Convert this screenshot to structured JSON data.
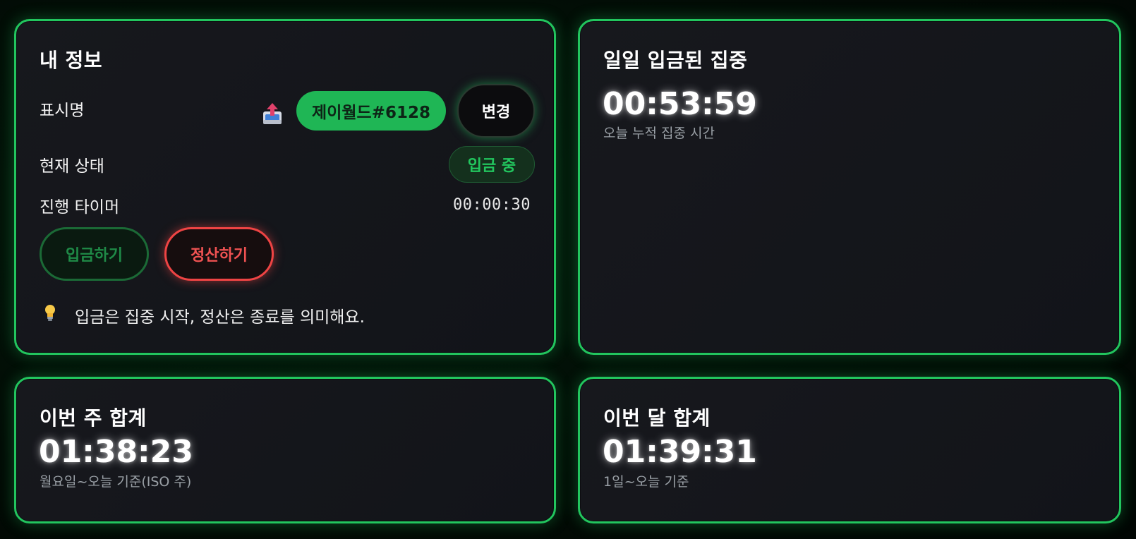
{
  "info": {
    "title": "내 정보",
    "display_name_label": "표시명",
    "display_name_value": "제이월드#6128",
    "change_label": "변경",
    "status_label": "현재 상태",
    "status_value": "입금 중",
    "timer_label": "진행 타이머",
    "timer_value": "00:00:30",
    "deposit_label": "입금하기",
    "settle_label": "정산하기",
    "tip_text": "입금은 집중 시작, 정산은 종료를 의미해요.",
    "icons": {
      "upload": "outbox-tray-icon",
      "tip": "light-bulb-icon"
    }
  },
  "daily": {
    "title": "일일 입금된 집중",
    "time": "00:53:59",
    "caption": "오늘 누적 집중 시간"
  },
  "weekly": {
    "title": "이번 주 합계",
    "time": "01:38:23",
    "caption": "월요일~오늘 기준(ISO 주)"
  },
  "monthly": {
    "title": "이번 달 합계",
    "time": "01:39:31",
    "caption": "1일~오늘 기준"
  },
  "colors": {
    "accent": "#22c55e",
    "danger": "#ef4444",
    "card_bg": "#15171c",
    "page_bg": "#020b05"
  }
}
